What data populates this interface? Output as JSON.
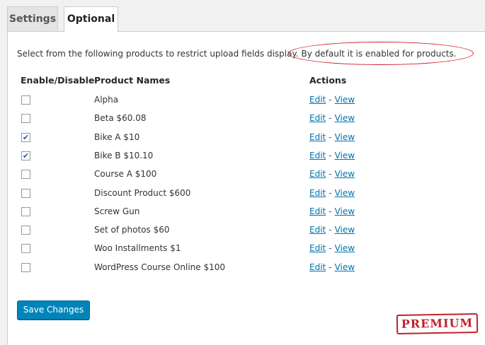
{
  "tabs": [
    {
      "label": "Settings"
    },
    {
      "label": "Optional"
    }
  ],
  "description": {
    "text": "Select from the following products to restrict upload fields display. By default it is enabled for products."
  },
  "table": {
    "headers": {
      "enable": "Enable/Disable",
      "name": "Product Names",
      "actions": "Actions"
    },
    "rows": [
      {
        "name": "Alpha",
        "checked": false,
        "edit": "Edit",
        "sep": "-",
        "view": "View"
      },
      {
        "name": "Beta $60.08",
        "checked": false,
        "edit": "Edit",
        "sep": "-",
        "view": "View"
      },
      {
        "name": "Bike A $10",
        "checked": true,
        "edit": "Edit",
        "sep": "-",
        "view": "View"
      },
      {
        "name": "Bike B $10.10",
        "checked": true,
        "edit": "Edit",
        "sep": "-",
        "view": "View"
      },
      {
        "name": "Course A $100",
        "checked": false,
        "edit": "Edit",
        "sep": "-",
        "view": "View"
      },
      {
        "name": "Discount Product $600",
        "checked": false,
        "edit": "Edit",
        "sep": "-",
        "view": "View"
      },
      {
        "name": "Screw Gun",
        "checked": false,
        "edit": "Edit",
        "sep": "-",
        "view": "View"
      },
      {
        "name": "Set of photos $60",
        "checked": false,
        "edit": "Edit",
        "sep": "-",
        "view": "View"
      },
      {
        "name": "Woo Installments $1",
        "checked": false,
        "edit": "Edit",
        "sep": "-",
        "view": "View"
      },
      {
        "name": "WordPress Course Online $100",
        "checked": false,
        "edit": "Edit",
        "sep": "-",
        "view": "View"
      }
    ]
  },
  "save_button": {
    "label": "Save Changes"
  },
  "badge": {
    "text": "PREMIUM",
    "color": "#c0222a"
  },
  "colors": {
    "accent": "#0085ba",
    "link": "#0073aa",
    "highlight": "#d0202a"
  }
}
